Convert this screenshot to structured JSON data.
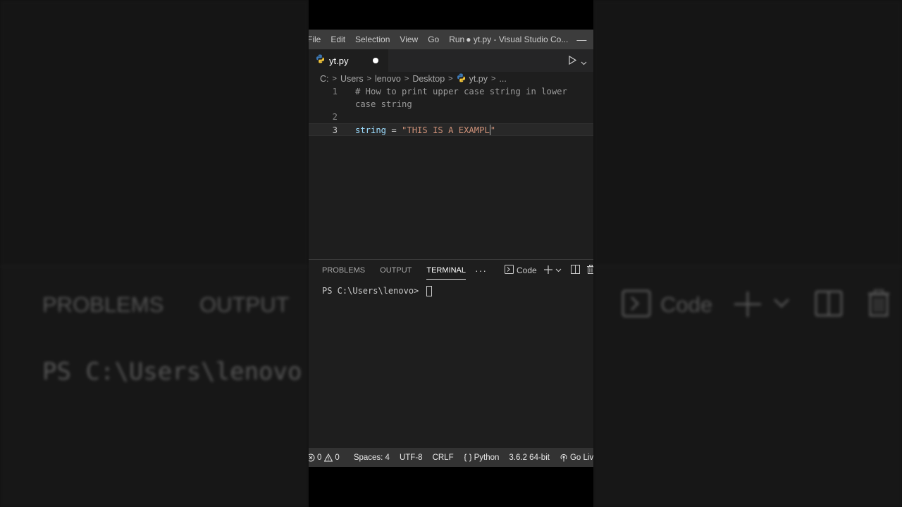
{
  "menu": [
    "File",
    "Edit",
    "Selection",
    "View",
    "Go",
    "Run"
  ],
  "window_title": "● yt.py - Visual Studio Co...",
  "tab": {
    "filename": "yt.py",
    "modified": true
  },
  "breadcrumb": [
    "C:",
    "Users",
    "lenovo",
    "Desktop",
    "yt.py",
    "..."
  ],
  "code_lines": [
    {
      "number": "1",
      "text_a": "# How to print upper case string in lower",
      "text_b": "case string"
    },
    {
      "number": "2",
      "text": ""
    },
    {
      "number": "3",
      "var": "string",
      "op": " = ",
      "str": "\"THIS IS A EXAMPL",
      "str_end": "\""
    }
  ],
  "panel": {
    "tabs": [
      "PROBLEMS",
      "OUTPUT",
      "TERMINAL"
    ],
    "active_tab": "TERMINAL",
    "more": "···",
    "terminal_profile": "Code",
    "prompt": "PS C:\\Users\\lenovo> "
  },
  "status": {
    "errors": "0",
    "warnings": "0",
    "spaces": "Spaces: 4",
    "encoding": "UTF-8",
    "eol": "CRLF",
    "language": "Python",
    "interpreter": "3.6.2 64-bit",
    "golive": "Go Live"
  },
  "background": {
    "tab1": "PROBLEMS",
    "tab2": "OUTPUT",
    "term": "PS C:\\Users\\lenovo",
    "code": "Code"
  }
}
